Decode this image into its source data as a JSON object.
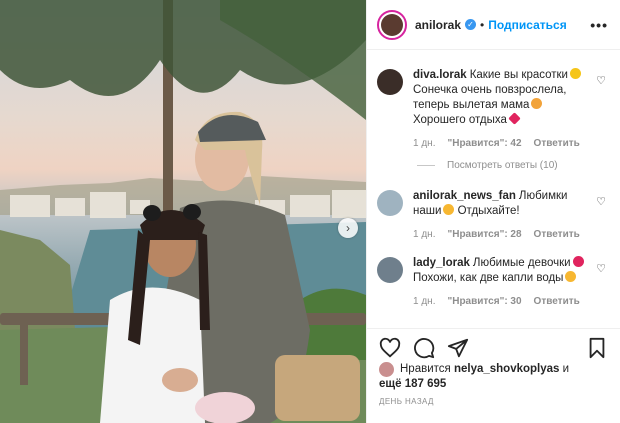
{
  "post": {
    "author": "anilorak",
    "follow_label": "Подписаться",
    "separator": "•",
    "more_label": "•••"
  },
  "comments": [
    {
      "user": "diva.lorak",
      "lines": [
        "Какие вы красотки",
        "Сонечка очень повзрослела,",
        "теперь вылетая мама",
        "Хорошего отдыха"
      ],
      "age": "1 дн.",
      "likes": "\"Нравится\": 42",
      "reply": "Ответить"
    },
    {
      "user": "anilorak_news_fan",
      "lines": [
        "Любимки",
        "наши",
        "Отдыхайте!"
      ],
      "age": "1 дн.",
      "likes": "\"Нравится\": 28",
      "reply": "Ответить"
    },
    {
      "user": "lady_lorak",
      "lines": [
        "Любимые девочки",
        "Похожи, как две капли воды"
      ],
      "age": "1 дн.",
      "likes": "\"Нравится\": 30",
      "reply": "Ответить"
    }
  ],
  "view_replies": "Посмотреть ответы (10)",
  "likes": {
    "liked_by_prefix": "Нравится",
    "liked_by_user": "nelya_shovkoplyas",
    "and": "и",
    "others": "ещё 187 695"
  },
  "date": "ДЕНЬ НАЗАД",
  "icons": {
    "verified": "verified-badge-icon",
    "like": "heart-icon",
    "comment": "comment-bubble-icon",
    "share": "paper-plane-icon",
    "save": "bookmark-icon",
    "next": "chevron-right-icon"
  },
  "colors": {
    "link": "#0095f6",
    "verified": "#3897f0",
    "muted": "#8e8e8e",
    "text": "#262626"
  }
}
